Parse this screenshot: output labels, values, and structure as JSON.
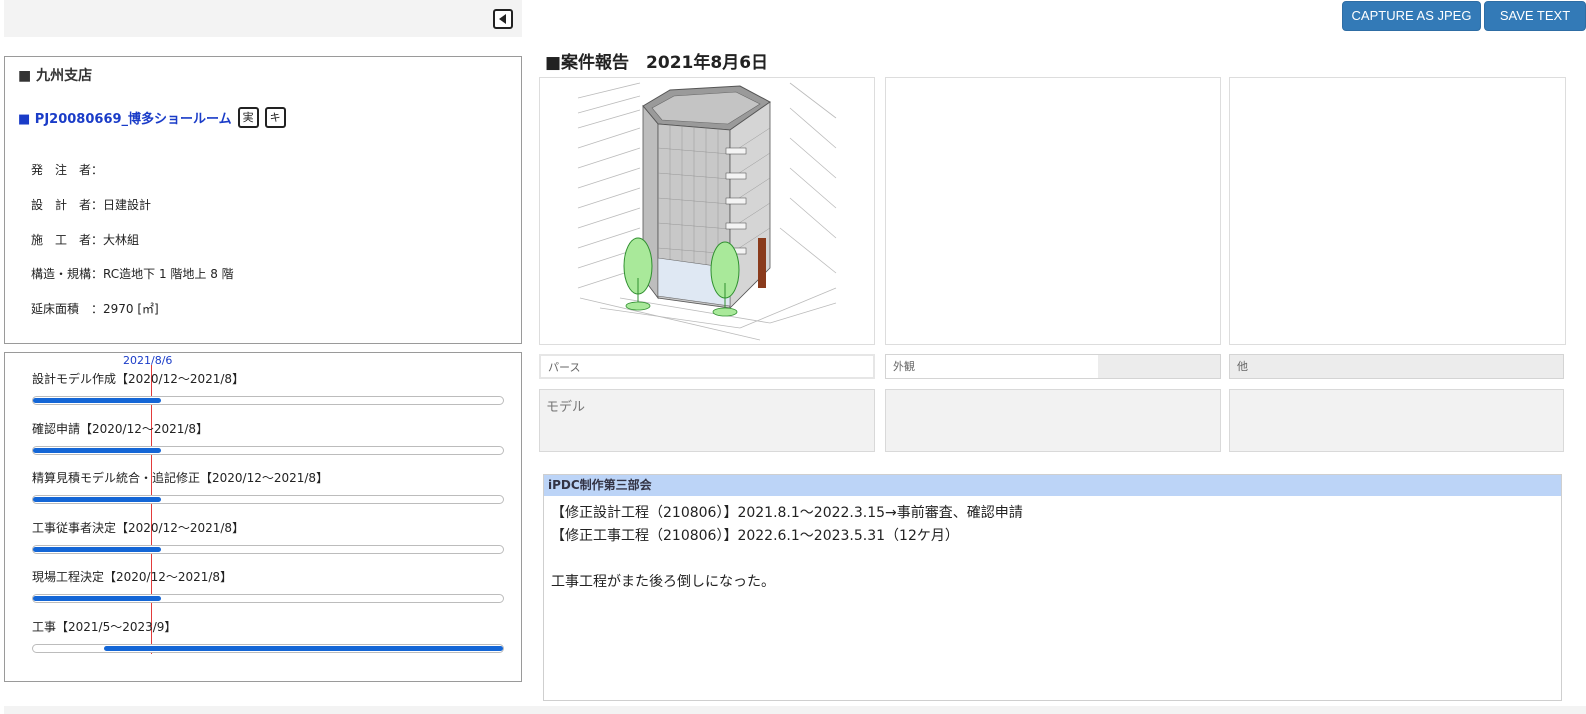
{
  "toolbar": {
    "capture_label": "CAPTURE AS JPEG",
    "save_label": "SAVE TEXT"
  },
  "info": {
    "branch": "■ 九州支店",
    "project": "■ PJ20080669_博多ショールーム",
    "tags": [
      "実",
      "キ"
    ],
    "rows": [
      {
        "label": "発　注　者：",
        "value": ""
      },
      {
        "label": "設　計　者：",
        "value": "日建設計"
      },
      {
        "label": "施　工　者：",
        "value": "大林組"
      },
      {
        "label": "構造・規構：",
        "value": "RC造地下 1 階地上 8 階"
      },
      {
        "label": "延床面積　：",
        "value": "2970 [㎡]"
      }
    ]
  },
  "schedule": {
    "today_label": "2021/8/6",
    "today_fraction": 0.243,
    "tasks": [
      {
        "label": "設計モデル作成【2020/12～2021/8】",
        "start": 0.0,
        "end": 0.273
      },
      {
        "label": "確認申請【2020/12～2021/8】",
        "start": 0.0,
        "end": 0.273
      },
      {
        "label": "精算見積モデル統合・追記修正【2020/12～2021/8】",
        "start": 0.0,
        "end": 0.273
      },
      {
        "label": "工事従事者決定【2020/12～2021/8】",
        "start": 0.0,
        "end": 0.273
      },
      {
        "label": "現場工程決定【2020/12～2021/8】",
        "start": 0.0,
        "end": 0.273
      },
      {
        "label": "工事【2021/5～2023/9】",
        "start": 0.152,
        "end": 1.0
      }
    ]
  },
  "report": {
    "title": "■案件報告　2021年8月6日",
    "captions": [
      "パース",
      "外観",
      "他"
    ],
    "notes": [
      "モデル",
      "",
      ""
    ],
    "comment_header": "iPDC制作第三部会",
    "comment_lines": [
      "【修正設計工程（210806）】2021.8.1～2022.3.15→事前審査、確認申請",
      "【修正工事工程（210806）】2022.6.1～2023.5.31（12ケ月）",
      "",
      "工事工程がまた後ろ倒しになった。"
    ]
  },
  "colors": {
    "accent_button": "#337ab7",
    "progress": "#1466d6",
    "today_line": "#e23b3b",
    "comment_header_bg": "#bcd4f7",
    "project_link": "#1a3cc8"
  }
}
